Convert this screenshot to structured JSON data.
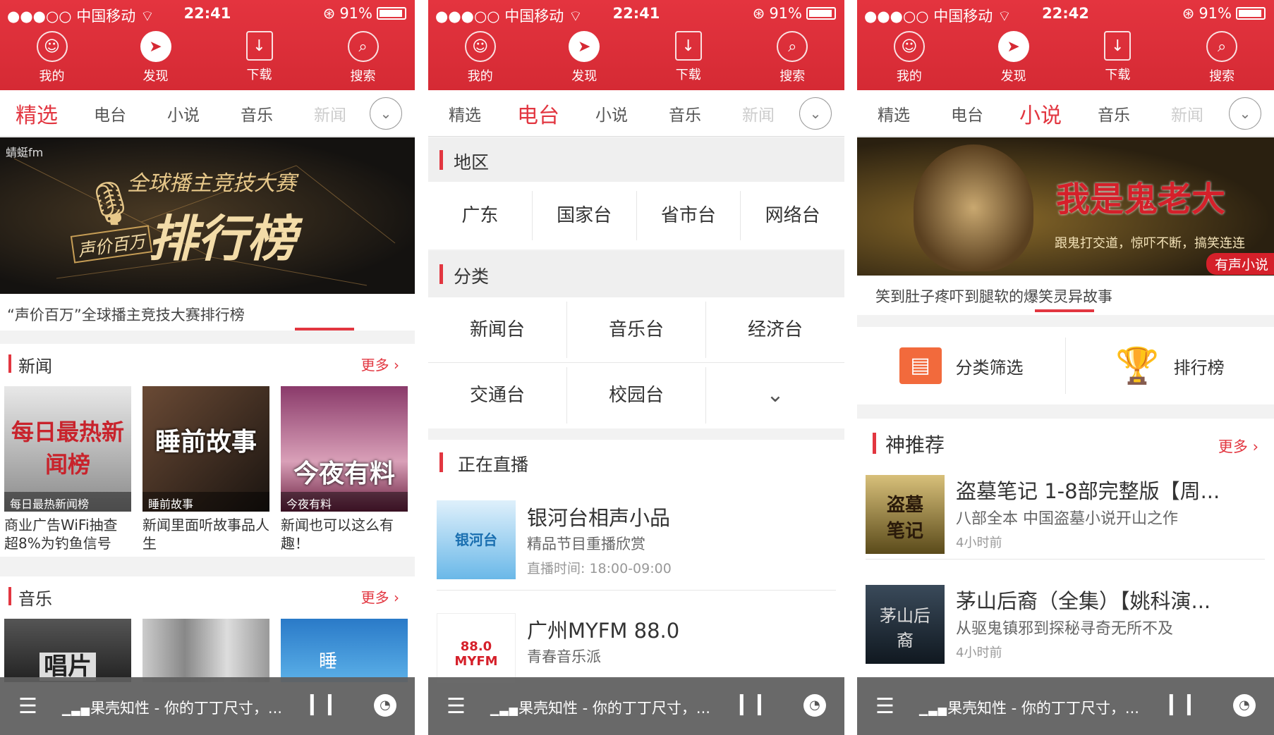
{
  "status": [
    {
      "carrier": "●●●○○ 中国移动 ",
      "time": "22:41",
      "battery": "91%"
    },
    {
      "carrier": "●●●○○ 中国移动 ",
      "time": "22:41",
      "battery": "91%"
    },
    {
      "carrier": "●●●○○ 中国移动 ",
      "time": "22:42",
      "battery": "91%"
    }
  ],
  "nav": {
    "mine": "我的",
    "discover": "发现",
    "download": "下载",
    "search": "搜索"
  },
  "tabs": {
    "featured": "精选",
    "radio": "电台",
    "novel": "小说",
    "music": "音乐",
    "news": "新闻"
  },
  "player": {
    "song": "果壳知性 - 你的丁丁尺寸，..."
  },
  "screen1": {
    "banner": {
      "brand": "蜻蜓fm",
      "line1": "全球播主竞技大赛",
      "line2": "排行榜",
      "badge": "声价百万"
    },
    "banner_caption": "“声价百万”全球播主竞技大赛排行榜",
    "news_section": {
      "title": "新闻",
      "more": "更多 ›"
    },
    "news_cards": [
      {
        "art": "每日最热新闻榜",
        "cap": "每日最热新闻榜",
        "text": "商业广告WiFi抽查超8%为钓鱼信号"
      },
      {
        "art": "睡前故事",
        "cap": "睡前故事",
        "text": "新闻里面听故事品人生"
      },
      {
        "art": "今夜有料",
        "cap": "今夜有料",
        "text": "新闻也可以这么有趣！"
      }
    ],
    "music_section": {
      "title": "音乐",
      "more": "更多 ›"
    },
    "music_cards": [
      {
        "art": "唱片"
      },
      {
        "art": ""
      },
      {
        "art": "睡"
      }
    ]
  },
  "screen2": {
    "region": {
      "title": "地区",
      "items": [
        "广东",
        "国家台",
        "省市台",
        "网络台"
      ]
    },
    "category": {
      "title": "分类",
      "items": [
        "新闻台",
        "音乐台",
        "经济台",
        "交通台",
        "校园台"
      ]
    },
    "live": {
      "title": "正在直播"
    },
    "stations": [
      {
        "logo": "银河台",
        "name": "银河台相声小品",
        "desc": "精品节目重播欣赏",
        "time": "直播时间: 18:00-09:00"
      },
      {
        "logo": "88.0 MYFM",
        "name": "广州MYFM 88.0",
        "desc": "青春音乐派",
        "time": ""
      }
    ]
  },
  "screen3": {
    "banner": {
      "title": "我是鬼老大",
      "sub": "跟鬼打交道，惊吓不断，搞笑连连",
      "tag": "有声小说"
    },
    "banner_caption": "笑到肚子疼吓到腿软的爆笑灵异故事",
    "filter": "分类筛选",
    "ranking": "排行榜",
    "recommend": {
      "title": "神推荐",
      "more": "更多 ›"
    },
    "books": [
      {
        "cover": "盗墓笔记",
        "title": "盗墓笔记 1-8部完整版【周...",
        "desc": "八部全本 中国盗墓小说开山之作",
        "time": "4小时前"
      },
      {
        "cover": "茅山后裔",
        "title": "茅山后裔（全集）【姚科演...",
        "desc": "从驱鬼镇邪到探秘寻奇无所不及",
        "time": "4小时前"
      }
    ]
  },
  "colors": {
    "brand_red": "#e23640",
    "player_bg": "#5f5f5f"
  }
}
